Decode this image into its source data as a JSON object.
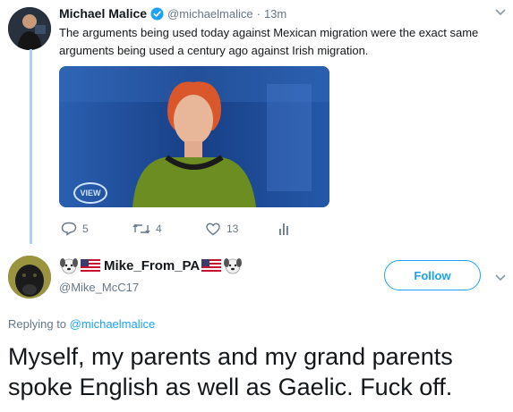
{
  "tweet1": {
    "author_name": "Michael Malice",
    "handle": "@michaelmalice",
    "separator": "·",
    "time": "13m",
    "text_line1": "The arguments being used today against Mexican migration were the exact same",
    "text_line2": "arguments being used a century ago against Irish migration.",
    "media_badge": "VIEW",
    "actions": {
      "replies": "5",
      "retweets": "4",
      "likes": "13"
    }
  },
  "tweet2": {
    "author_name": "Mike_From_PA",
    "handle": "@Mike_McC17",
    "follow_label": "Follow",
    "replying_prefix": "Replying to",
    "replying_handle": "@michaelmalice",
    "text_line1": "Myself, my parents and my grand parents",
    "text_line2": "spoke English as well as Gaelic. Fuck off."
  },
  "colors": {
    "accent": "#1da1f2",
    "thread_line": "#a6d1ef",
    "muted": "#657786"
  }
}
